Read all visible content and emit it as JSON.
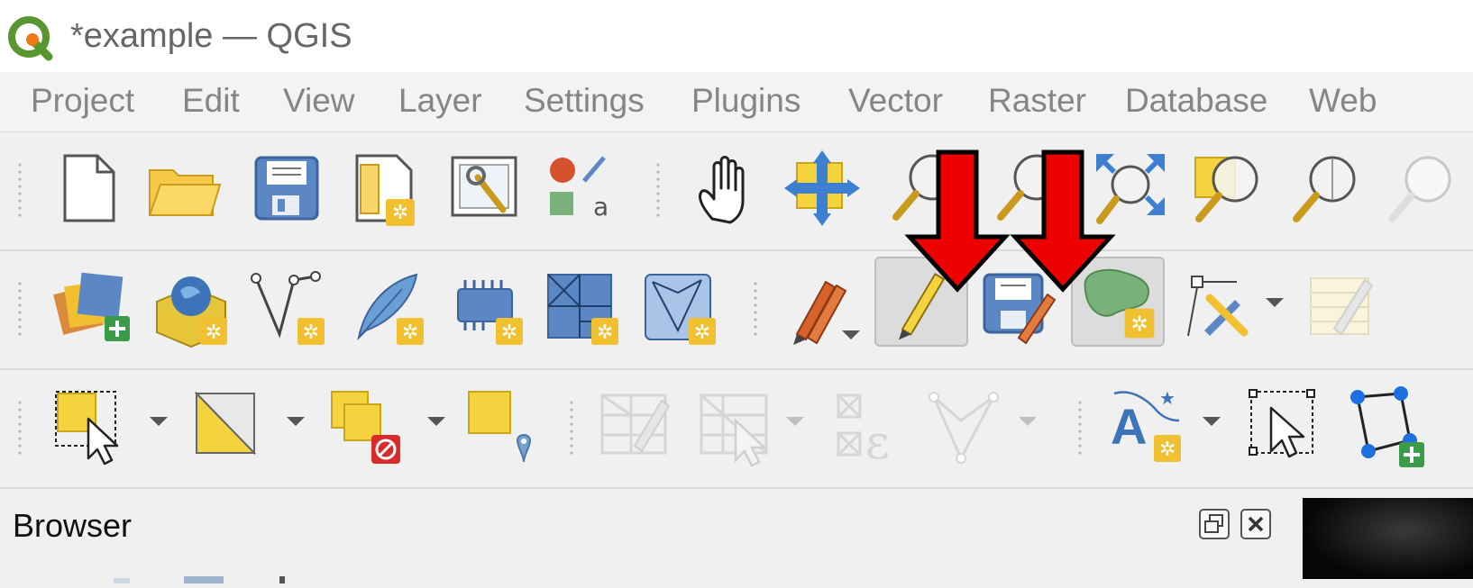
{
  "window": {
    "title": "*example — QGIS",
    "logo_icon": "qgis-logo-icon"
  },
  "menubar": {
    "items": [
      "Project",
      "Edit",
      "View",
      "Layer",
      "Settings",
      "Plugins",
      "Vector",
      "Raster",
      "Database",
      "Web"
    ]
  },
  "toolbars": {
    "project": [
      "new-project-icon",
      "open-project-icon",
      "save-project-icon",
      "new-print-layout-icon",
      "layout-manager-icon",
      "style-manager-icon"
    ],
    "navigation": [
      "pan-map-icon",
      "pan-to-selection-icon",
      "zoom-in-icon",
      "zoom-out-icon",
      "zoom-full-icon",
      "zoom-to-selection-icon",
      "zoom-to-layer-icon",
      "zoom-native-icon"
    ],
    "data_source": [
      "data-source-manager-icon",
      "new-geopackage-layer-icon",
      "new-shapefile-layer-icon",
      "new-spatialite-layer-icon",
      "new-virtual-layer-icon",
      "new-temporary-layer-icon",
      "new-mesh-layer-icon"
    ],
    "digitizing": [
      "current-edits-icon",
      "toggle-editing-icon",
      "save-layer-edits-icon",
      "digitize-polygon-icon",
      "vertex-tool-icon",
      "modify-attributes-icon"
    ],
    "selection": [
      "select-features-icon",
      "select-by-expression-icon",
      "deselect-features-icon",
      "select-by-location-icon",
      "open-attribute-table-icon",
      "field-calculator-icon",
      "statistical-summary-icon",
      "identify-features-icon",
      "label-toolbar-icon",
      "select-pin-icon",
      "node-tool-icon"
    ]
  },
  "annotations": {
    "arrow_color": "#ee0000"
  },
  "dock": {
    "title": "Browser"
  }
}
